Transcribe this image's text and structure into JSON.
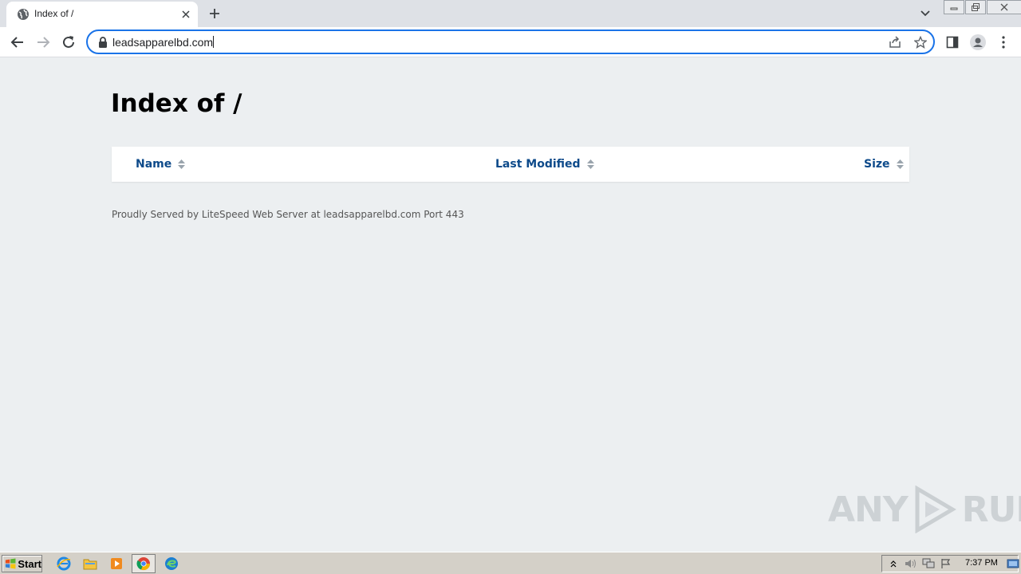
{
  "browser": {
    "tab_title": "Index of /",
    "url": "leadsapparelbd.com"
  },
  "page": {
    "title": "Index of /",
    "columns": [
      "Name",
      "Last Modified",
      "Size"
    ],
    "footer": "Proudly Served by LiteSpeed Web Server at leadsapparelbd.com Port 443"
  },
  "watermark": {
    "left": "ANY",
    "right": "RUN"
  },
  "taskbar": {
    "start_label": "Start",
    "clock": "7:37 PM"
  },
  "colors": {
    "accent": "#1a73e8",
    "column_header": "#0d4a8a",
    "page_background": "#eceff1"
  }
}
